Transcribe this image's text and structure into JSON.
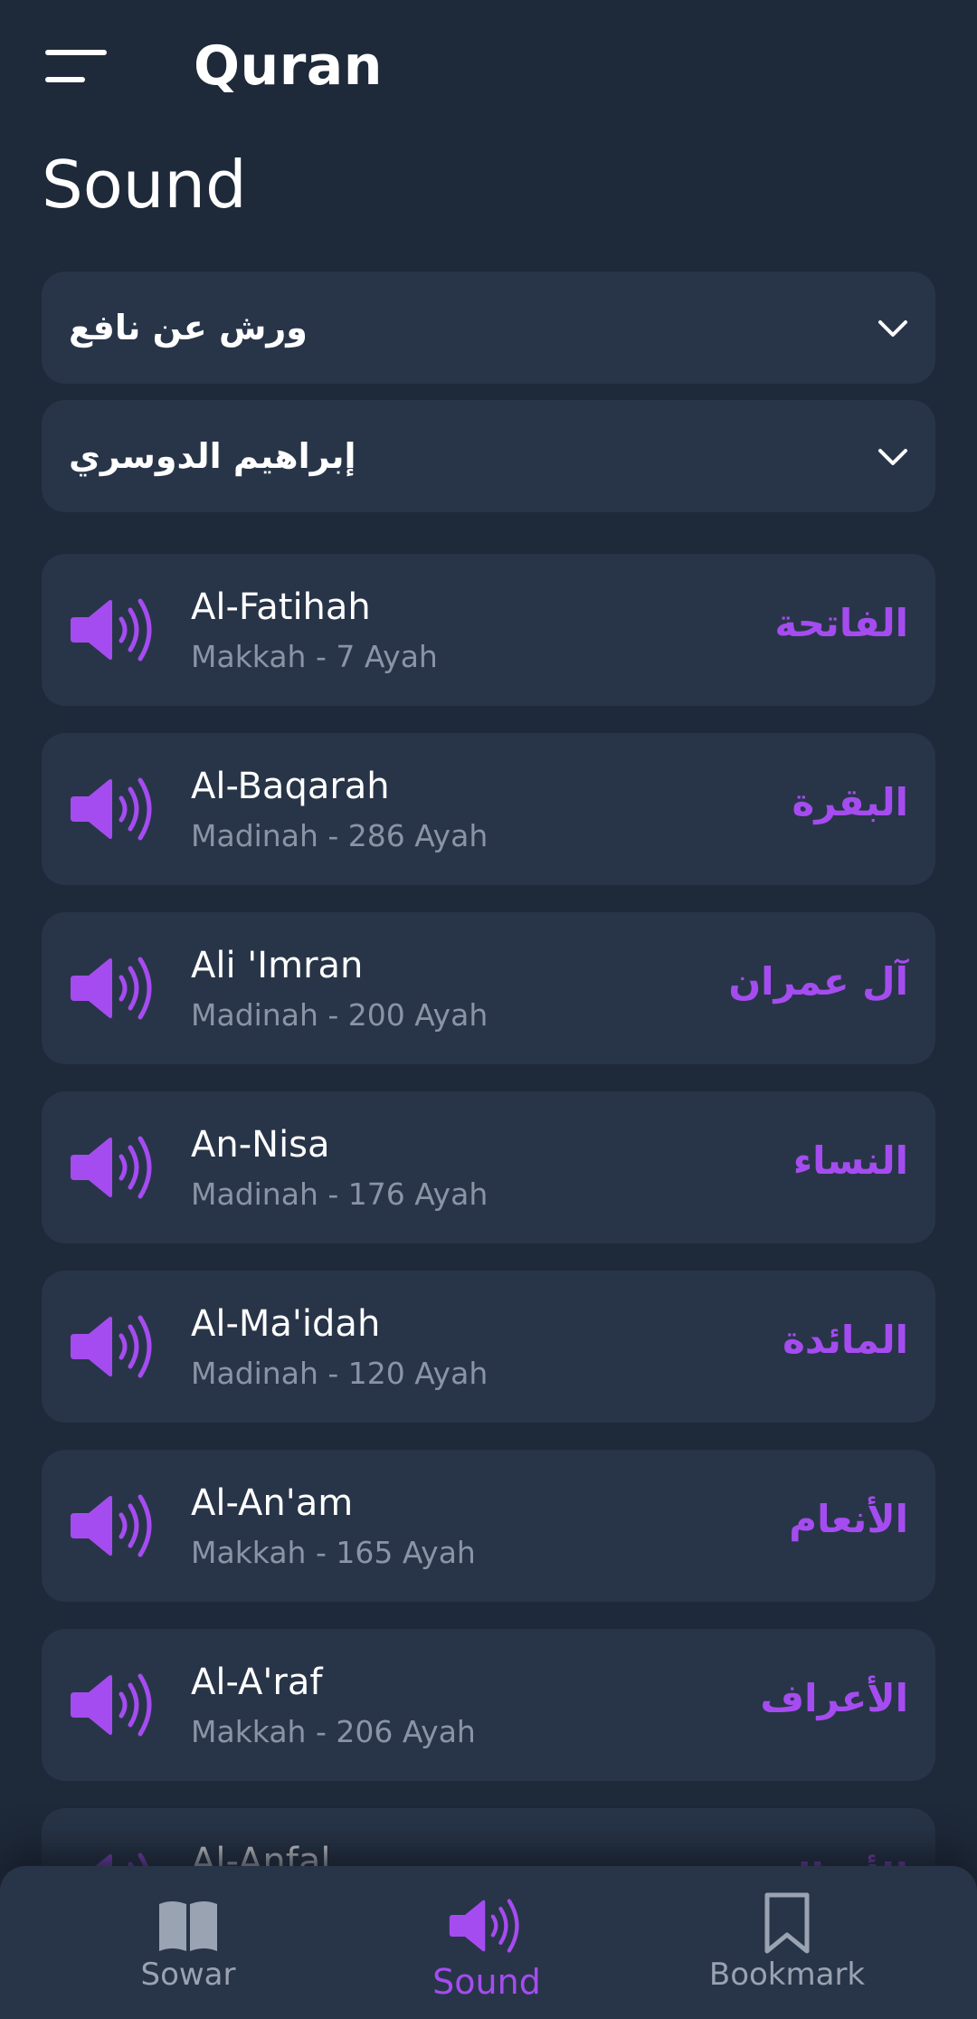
{
  "header": {
    "app_title": "Quran",
    "page_title": "Sound"
  },
  "selects": {
    "riwaya": "ورش عن نافع",
    "reciter": "إبراهيم الدوسري"
  },
  "surahs": [
    {
      "name": "Al-Fatihah",
      "meta": "Makkah - 7 Ayah",
      "arabic": "الفاتحة"
    },
    {
      "name": "Al-Baqarah",
      "meta": "Madinah - 286 Ayah",
      "arabic": "البقرة"
    },
    {
      "name": "Ali 'Imran",
      "meta": "Madinah - 200 Ayah",
      "arabic": "آل عمران"
    },
    {
      "name": "An-Nisa",
      "meta": "Madinah - 176 Ayah",
      "arabic": "النساء"
    },
    {
      "name": "Al-Ma'idah",
      "meta": "Madinah - 120 Ayah",
      "arabic": "المائدة"
    },
    {
      "name": "Al-An'am",
      "meta": "Makkah - 165 Ayah",
      "arabic": "الأنعام"
    },
    {
      "name": "Al-A'raf",
      "meta": "Makkah - 206 Ayah",
      "arabic": "الأعراف"
    },
    {
      "name": "Al-Anfal",
      "meta": "",
      "arabic": "الأنفال"
    }
  ],
  "nav": {
    "sowar": "Sowar",
    "sound": "Sound",
    "bookmark": "Bookmark",
    "active": "sound"
  },
  "colors": {
    "background": "#1e2939",
    "card": "#283548",
    "accent": "#a54cf0",
    "muted": "#8a94a6"
  },
  "icons": {
    "menu": "hamburger-icon",
    "dropdown": "chevron-down-icon",
    "surah": "speaker-icon",
    "nav_sowar": "book-icon",
    "nav_sound": "speaker-icon",
    "nav_bookmark": "bookmark-icon"
  }
}
